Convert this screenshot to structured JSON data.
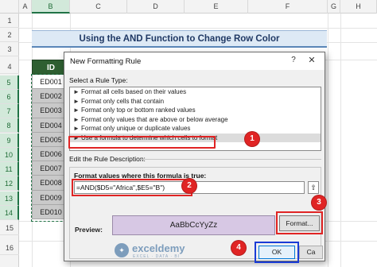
{
  "sheet": {
    "columns": [
      "A",
      "B",
      "C",
      "D",
      "E",
      "F",
      "G",
      "H"
    ],
    "rows": [
      "1",
      "2",
      "3",
      "4",
      "5",
      "6",
      "7",
      "8",
      "9",
      "10",
      "11",
      "12",
      "13",
      "14",
      "15",
      "16"
    ],
    "title": "Using the AND Function to Change Row Color",
    "id_header": "ID",
    "ids": [
      "ED001",
      "ED002",
      "ED003",
      "ED004",
      "ED005",
      "ED006",
      "ED007",
      "ED008",
      "ED009",
      "ED010"
    ]
  },
  "dialog": {
    "title": "New Formatting Rule",
    "help": "?",
    "close": "✕",
    "select_rule_label": "Select a Rule Type:",
    "rule_types": [
      "Format all cells based on their values",
      "Format only cells that contain",
      "Format only top or bottom ranked values",
      "Format only values that are above or below average",
      "Format only unique or duplicate values",
      "Use a formula to determine which cells to format"
    ],
    "edit_label": "Edit the Rule Description:",
    "formula_label": "Format values where this formula is true:",
    "formula_value": "=AND($D5=\"Africa\",$E5=\"B\")",
    "ref_icon": "⇧",
    "preview_label": "Preview:",
    "preview_text": "AaBbCcYyZz",
    "preview_color": "#d7c8e4",
    "format_button": "Format...",
    "ok_button": "OK",
    "cancel_button": "Ca"
  },
  "badges": [
    "1",
    "2",
    "3",
    "4"
  ],
  "watermark": {
    "name": "exceldemy",
    "tagline": "EXCEL · DATA · BI"
  }
}
